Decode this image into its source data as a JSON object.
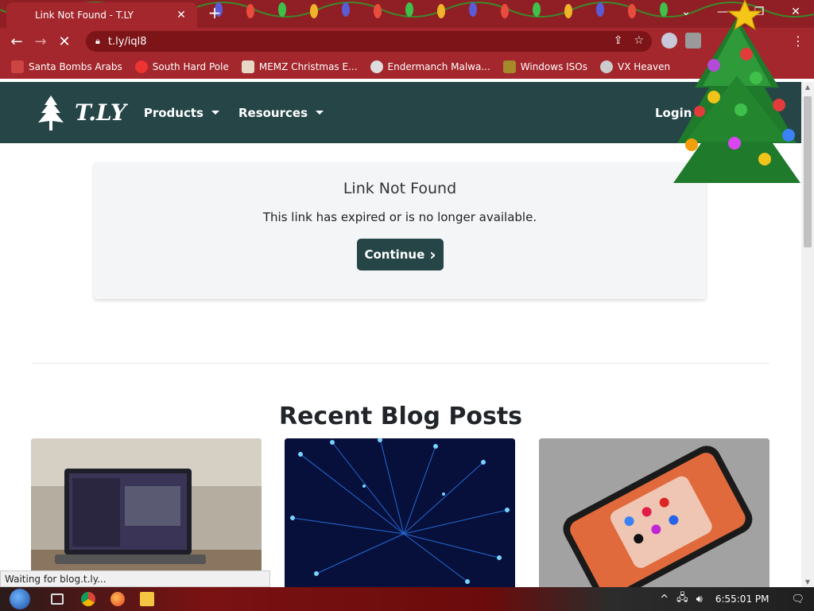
{
  "browser": {
    "tab_title": "Link Not Found - T.LY",
    "tab_close": "✕",
    "new_tab": "+",
    "url": "t.ly/iql8",
    "window_controls": {
      "minimize": "—",
      "restore": "❐",
      "close": "✕"
    },
    "bookmarks": [
      {
        "label": "Santa Bombs Arabs"
      },
      {
        "label": "South Hard Pole"
      },
      {
        "label": "MEMZ Christmas E..."
      },
      {
        "label": "Endermanch Malwa..."
      },
      {
        "label": "Windows ISOs"
      },
      {
        "label": "VX Heaven"
      }
    ],
    "status_text": "Waiting for blog.t.ly..."
  },
  "site": {
    "logo_text": "T.LY",
    "nav": [
      {
        "label": "Products"
      },
      {
        "label": "Resources"
      }
    ],
    "login": "Login",
    "card": {
      "title": "Link Not Found",
      "message": "This link has expired or is no longer available.",
      "button": "Continue",
      "button_icon": "›"
    },
    "blog_heading": "Recent Blog Posts",
    "blog_posts": [
      {
        "image": "laptop-photo"
      },
      {
        "image": "fiber-optic-photo"
      },
      {
        "image": "smartphone-photo"
      }
    ]
  },
  "taskbar": {
    "clock": "6:55:01 PM"
  },
  "colors": {
    "brand": "#254547",
    "browser_chrome": "#a3272c"
  }
}
